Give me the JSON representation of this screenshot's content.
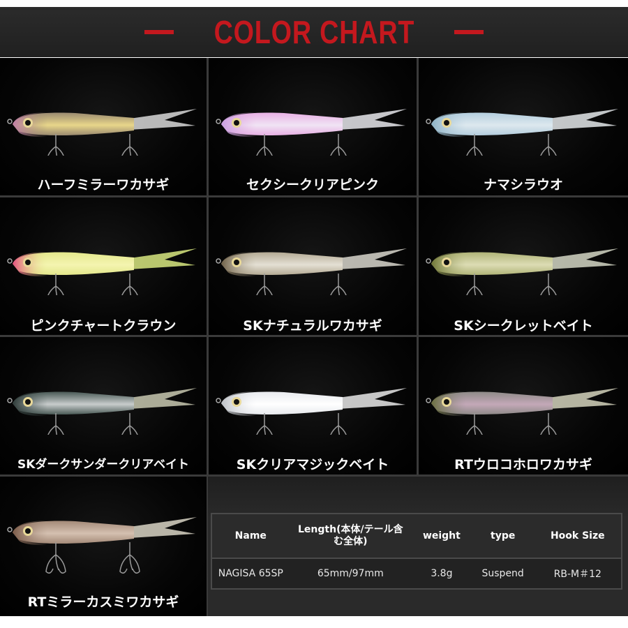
{
  "header": {
    "title": "COLOR CHART",
    "accent_color": "#c4181e"
  },
  "colors": [
    {
      "name": "ハーフミラーワカサギ",
      "head": "#c27fa8",
      "body": "#9a8a70",
      "belly": "#e8d68a",
      "tail": "#d8d8d8"
    },
    {
      "name": "セクシークリアピンク",
      "head": "#c9a0e0",
      "body": "#e8b0e4",
      "belly": "#f0e4f4",
      "tail": "#e8e8ec"
    },
    {
      "name": "ナマシラウオ",
      "head": "#8fb2c4",
      "body": "#b4cede",
      "belly": "#dde8ee",
      "tail": "#e4e8ea"
    },
    {
      "name": "ピンクチャートクラウン",
      "head": "#e2507e",
      "body": "#e4e88c",
      "belly": "#f4f4b0",
      "tail": "#d8e880"
    },
    {
      "name": "SKナチュラルワカサギ",
      "head": "#6e6048",
      "body": "#b4aa94",
      "belly": "#e4e0d4",
      "tail": "#d8d6cc"
    },
    {
      "name": "SKシークレットベイト",
      "head": "#6e7436",
      "body": "#b0b478",
      "belly": "#dcdcb4",
      "tail": "#d4d6c4"
    },
    {
      "name": "SKダークサンダークリアベイト",
      "head": "#2e3a38",
      "body": "#4a5a56",
      "belly": "#c8cccc",
      "tail": "#c8c8b0"
    },
    {
      "name": "SKクリアマジックベイト",
      "head": "#bcc0c4",
      "body": "#e8eaee",
      "belly": "#ffffff",
      "tail": "#e8e8e8"
    },
    {
      "name": "RTウロコホロワカサギ",
      "head": "#6a6e3e",
      "body": "#8e8a88",
      "belly": "#c4a8b8",
      "tail": "#d4d2bc"
    },
    {
      "name": "RTミラーカスミワカサギ",
      "head": "#7a5a48",
      "body": "#a48a78",
      "belly": "#d4c0b0",
      "tail": "#d8d4c4"
    }
  ],
  "spec": {
    "headers": [
      "Name",
      "Length(本体/テール含む全体)",
      "weight",
      "type",
      "Hook Size"
    ],
    "row": [
      "NAGISA 65SP",
      "65mm/97mm",
      "3.8g",
      "Suspend",
      "RB-M＃12"
    ]
  }
}
